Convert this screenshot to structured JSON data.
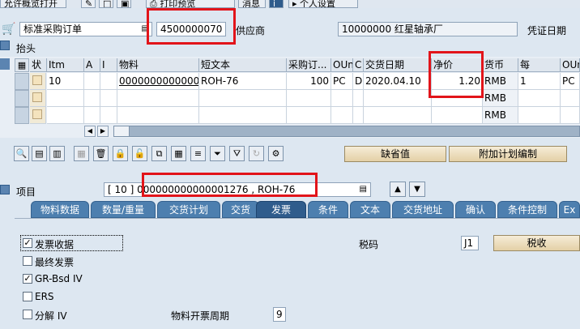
{
  "toolbar": {
    "item1": "允许概览打开",
    "item2": "打印预览",
    "item3": "消息",
    "item4": "个人设置"
  },
  "header": {
    "po_type": "标准采购订单",
    "po_number": "4500000070",
    "supplier_label": "供应商",
    "supplier_value": "10000000 红星轴承厂",
    "doc_date_label": "凭证日期",
    "header_label": "抬头"
  },
  "grid": {
    "columns": [
      "状",
      "Itm",
      "A",
      "I",
      "物料",
      "短文本",
      "采购订...",
      "OUn",
      "C",
      "交货日期",
      "净价",
      "货币",
      "每",
      "OUn"
    ],
    "rows": [
      {
        "itm": "10",
        "a": "",
        "i": "",
        "material": "000000000000001276",
        "short_text": "ROH-76",
        "qty": "100",
        "oun": "PC",
        "c": "D",
        "date": "2020.04.10",
        "price": "1.20",
        "currency": "RMB",
        "per": "1",
        "oun2": "PC"
      },
      {
        "itm": "",
        "a": "",
        "i": "",
        "material": "",
        "short_text": "",
        "qty": "",
        "oun": "",
        "c": "",
        "date": "",
        "price": "",
        "currency": "RMB",
        "per": "",
        "oun2": ""
      },
      {
        "itm": "",
        "a": "",
        "i": "",
        "material": "",
        "short_text": "",
        "qty": "",
        "oun": "",
        "c": "",
        "date": "",
        "price": "",
        "currency": "RMB",
        "per": "",
        "oun2": ""
      }
    ]
  },
  "buttons": {
    "default_values": "缺省值",
    "additional_planning": "附加计划编制"
  },
  "item": {
    "label": "项目",
    "selector": "[ 10 ] 000000000000001276 , ROH-76"
  },
  "tabs": [
    "物料数据",
    "数量/重量",
    "交货计划",
    "交货",
    "发票",
    "条件",
    "文本",
    "交货地址",
    "确认",
    "条件控制",
    "Ex"
  ],
  "invoice": {
    "inv_receipt": "发票收据",
    "final_invoice": "最终发票",
    "gr_bsd_iv": "GR-Bsd IV",
    "ers": "ERS",
    "split_iv": "分解 IV",
    "tax_code_label": "税码",
    "tax_code_value": "J1",
    "tax_button": "税收",
    "billing_period_label": "物料开票周期",
    "billing_period_value": "9",
    "inv_receipt_checked": "✓",
    "gr_bsd_iv_checked": "✓"
  },
  "colors": {
    "highlight": "#e2141a",
    "tab_bg": "#4d7faf",
    "panel_bg": "#dde7f1"
  }
}
